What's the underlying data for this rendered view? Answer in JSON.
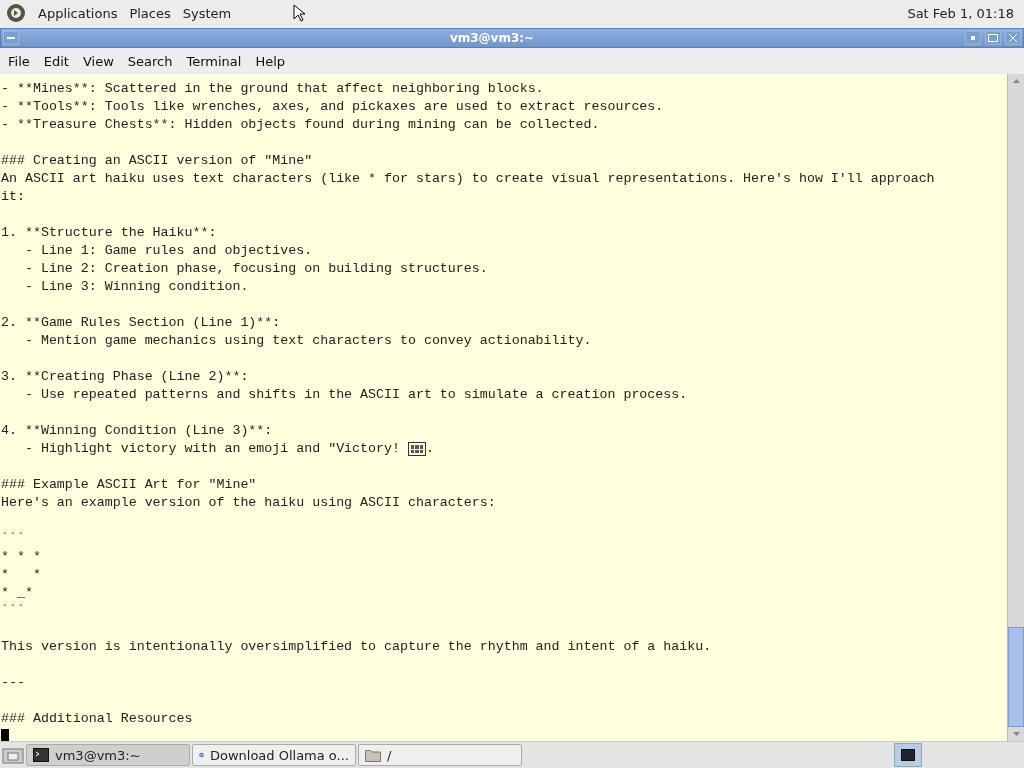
{
  "top_panel": {
    "menus": [
      "Applications",
      "Places",
      "System"
    ],
    "clock": "Sat Feb 1, 01:18"
  },
  "window": {
    "title": "vm3@vm3:~"
  },
  "menubar": [
    "File",
    "Edit",
    "View",
    "Search",
    "Terminal",
    "Help"
  ],
  "terminal": {
    "lines": [
      {
        "kind": "text",
        "text": "- **Mines**: Scattered in the ground that affect neighboring blocks."
      },
      {
        "kind": "text",
        "text": "- **Tools**: Tools like wrenches, axes, and pickaxes are used to extract resources."
      },
      {
        "kind": "text",
        "text": "- **Treasure Chests**: Hidden objects found during mining can be collected."
      },
      {
        "kind": "blank"
      },
      {
        "kind": "text",
        "text": "### Creating an ASCII version of \"Mine\""
      },
      {
        "kind": "text",
        "text": "An ASCII art haiku uses text characters (like * for stars) to create visual representations. Here's how I'll approach"
      },
      {
        "kind": "text",
        "text": "it:"
      },
      {
        "kind": "blank"
      },
      {
        "kind": "text",
        "text": "1. **Structure the Haiku**:"
      },
      {
        "kind": "text",
        "text": "   - Line 1: Game rules and objectives."
      },
      {
        "kind": "text",
        "text": "   - Line 2: Creation phase, focusing on building structures."
      },
      {
        "kind": "text",
        "text": "   - Line 3: Winning condition."
      },
      {
        "kind": "blank"
      },
      {
        "kind": "text",
        "text": "2. **Game Rules Section (Line 1)**:"
      },
      {
        "kind": "text",
        "text": "   - Mention game mechanics using text characters to convey actionability."
      },
      {
        "kind": "blank"
      },
      {
        "kind": "text",
        "text": "3. **Creating Phase (Line 2)**:"
      },
      {
        "kind": "text",
        "text": "   - Use repeated patterns and shifts in the ASCII art to simulate a creation process."
      },
      {
        "kind": "blank"
      },
      {
        "kind": "text",
        "text": "4. **Winning Condition (Line 3)**:"
      },
      {
        "kind": "glyph",
        "text": "   - Highlight victory with an emoji and \"Victory! ",
        "after": "."
      },
      {
        "kind": "blank"
      },
      {
        "kind": "text",
        "text": "### Example ASCII Art for \"Mine\""
      },
      {
        "kind": "text",
        "text": "Here's an example version of the haiku using ASCII characters:"
      },
      {
        "kind": "blank"
      },
      {
        "kind": "text",
        "text": "```"
      },
      {
        "kind": "text",
        "text": "* * *"
      },
      {
        "kind": "text",
        "text": "*   *"
      },
      {
        "kind": "text",
        "text": "* _*"
      },
      {
        "kind": "text",
        "text": "```"
      },
      {
        "kind": "blank"
      },
      {
        "kind": "text",
        "text": "This version is intentionally oversimplified to capture the rhythm and intent of a haiku."
      },
      {
        "kind": "blank"
      },
      {
        "kind": "text",
        "text": "---"
      },
      {
        "kind": "blank"
      },
      {
        "kind": "text",
        "text": "### Additional Resources"
      },
      {
        "kind": "cursor"
      }
    ]
  },
  "taskbar": {
    "tasks": [
      {
        "kind": "terminal",
        "label": "vm3@vm3:~",
        "selected": true
      },
      {
        "kind": "browser",
        "label": "Download Ollama o...",
        "selected": false
      },
      {
        "kind": "folder",
        "label": "/",
        "selected": false
      }
    ]
  }
}
